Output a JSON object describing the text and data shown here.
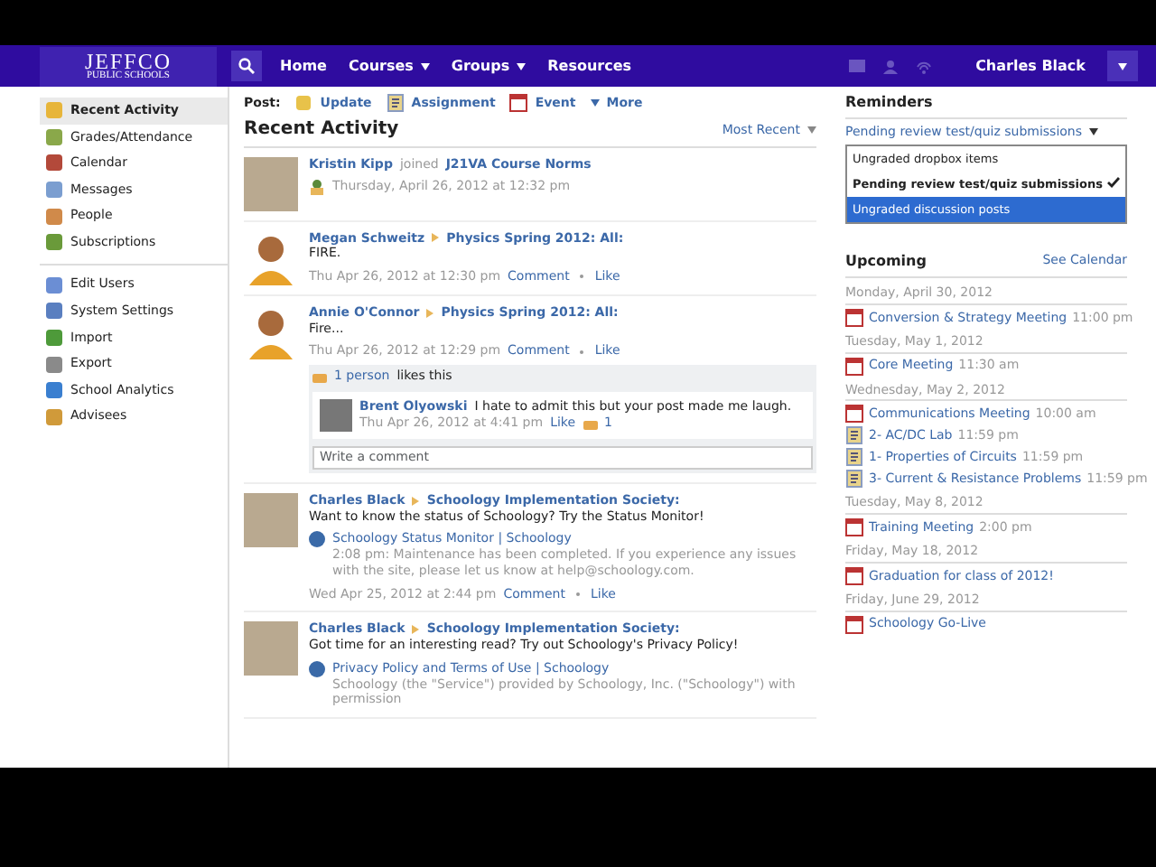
{
  "navbar": {
    "logo_title": "JEFFCO",
    "logo_subtitle": "PUBLIC SCHOOLS",
    "links": [
      {
        "label": "Home",
        "dropdown": false
      },
      {
        "label": "Courses",
        "dropdown": true
      },
      {
        "label": "Groups",
        "dropdown": true
      },
      {
        "label": "Resources",
        "dropdown": false
      }
    ],
    "user": "Charles Black"
  },
  "sidebar": {
    "groups": [
      [
        {
          "label": "Recent Activity",
          "selected": true
        },
        {
          "label": "Grades/Attendance",
          "selected": false
        },
        {
          "label": "Calendar",
          "selected": false
        },
        {
          "label": "Messages",
          "selected": false
        },
        {
          "label": "People",
          "selected": false
        },
        {
          "label": "Subscriptions",
          "selected": false
        }
      ],
      [
        {
          "label": "Edit Users",
          "selected": false
        },
        {
          "label": "System Settings",
          "selected": false
        },
        {
          "label": "Import",
          "selected": false
        },
        {
          "label": "Export",
          "selected": false
        },
        {
          "label": "School Analytics",
          "selected": false
        },
        {
          "label": "Advisees",
          "selected": false
        }
      ]
    ]
  },
  "post_bar": {
    "label": "Post:",
    "options": [
      {
        "label": "Update",
        "kind": "update"
      },
      {
        "label": "Assignment",
        "kind": "assignment"
      },
      {
        "label": "Event",
        "kind": "event"
      },
      {
        "label": "More",
        "kind": "more"
      }
    ]
  },
  "feed": {
    "heading": "Recent Activity",
    "sort": "Most Recent",
    "posts": [
      {
        "kind": "photo",
        "author": "Kristin Kipp",
        "verb": "joined",
        "target": "J21VA Course Norms",
        "time": "Thursday, April 26, 2012 at 12:32 pm"
      },
      {
        "kind": "silhouette",
        "author": "Megan Schweitz",
        "target": "Physics Spring 2012: All:",
        "body": "FIRE.",
        "time": "Thu Apr 26, 2012 at 12:30 pm",
        "actions": [
          "Comment",
          "Like"
        ]
      },
      {
        "kind": "silhouette",
        "author": "Annie O'Connor",
        "target": "Physics Spring 2012: All:",
        "body": "Fire...",
        "time": "Thu Apr 26, 2012 at 12:29 pm",
        "actions": [
          "Comment",
          "Like"
        ],
        "likes": {
          "count": "1 person",
          "text": "likes this"
        },
        "comments": [
          {
            "author": "Brent Olyowski",
            "text": "I hate to admit this but your post made me laugh.",
            "time": "Thu Apr 26, 2012 at 4:41 pm",
            "like": "Like",
            "like_count": "1"
          }
        ],
        "comment_placeholder": "Write a comment"
      },
      {
        "kind": "photo",
        "author": "Charles Black",
        "target": "Schoology Implementation Society:",
        "body": "Want to know the status of Schoology? Try the Status Monitor!",
        "link": {
          "title": "Schoology Status Monitor | Schoology",
          "description": "2:08 pm: Maintenance has been completed. If you experience any issues with the site, please let us know at help@schoology.com."
        },
        "time": "Wed Apr 25, 2012 at 2:44 pm",
        "actions": [
          "Comment",
          "Like"
        ]
      },
      {
        "kind": "photo",
        "author": "Charles Black",
        "target": "Schoology Implementation Society:",
        "body": "Got time for an interesting read? Try out Schoology's Privacy Policy!",
        "link": {
          "title": "Privacy Policy and Terms of Use | Schoology",
          "description": "Schoology (the \"Service\") provided by Schoology, Inc. (\"Schoology\") with permission"
        }
      }
    ]
  },
  "reminders": {
    "heading": "Reminders",
    "selector": "Pending review test/quiz submissions",
    "options": [
      {
        "label": "Ungraded dropbox items",
        "selected": false,
        "hovered": false
      },
      {
        "label": "Pending review test/quiz submissions",
        "selected": true,
        "hovered": false
      },
      {
        "label": "Ungraded discussion posts",
        "selected": false,
        "hovered": true
      }
    ]
  },
  "upcoming": {
    "heading": "Upcoming",
    "link": "See Calendar",
    "days": [
      {
        "date": "Monday, April 30, 2012",
        "events": [
          {
            "kind": "event",
            "title": "Conversion & Strategy Meeting",
            "time": "11:00 pm"
          }
        ]
      },
      {
        "date": "Tuesday, May 1, 2012",
        "events": [
          {
            "kind": "event",
            "title": "Core Meeting",
            "time": "11:30 am"
          }
        ]
      },
      {
        "date": "Wednesday, May 2, 2012",
        "events": [
          {
            "kind": "event",
            "title": "Communications Meeting",
            "time": "10:00 am"
          },
          {
            "kind": "assignment",
            "title": "2- AC/DC Lab",
            "time": "11:59 pm"
          },
          {
            "kind": "assignment",
            "title": "1- Properties of Circuits",
            "time": "11:59 pm"
          },
          {
            "kind": "assignment",
            "title": "3- Current & Resistance Problems",
            "time": "11:59 pm"
          }
        ]
      },
      {
        "date": "Tuesday, May 8, 2012",
        "events": [
          {
            "kind": "event",
            "title": "Training Meeting",
            "time": "2:00 pm"
          }
        ]
      },
      {
        "date": "Friday, May 18, 2012",
        "events": [
          {
            "kind": "event",
            "title": "Graduation for class of 2012!"
          }
        ]
      },
      {
        "date": "Friday, June 29, 2012",
        "events": [
          {
            "kind": "event",
            "title": "Schoology Go-Live"
          }
        ]
      }
    ]
  }
}
